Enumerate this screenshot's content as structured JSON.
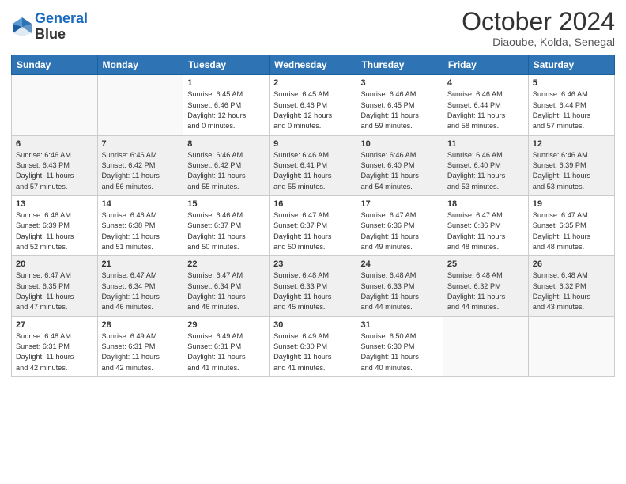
{
  "header": {
    "logo_line1": "General",
    "logo_line2": "Blue",
    "month": "October 2024",
    "location": "Diaoube, Kolda, Senegal"
  },
  "days_of_week": [
    "Sunday",
    "Monday",
    "Tuesday",
    "Wednesday",
    "Thursday",
    "Friday",
    "Saturday"
  ],
  "weeks": [
    [
      {
        "day": "",
        "info": ""
      },
      {
        "day": "",
        "info": ""
      },
      {
        "day": "1",
        "info": "Sunrise: 6:45 AM\nSunset: 6:46 PM\nDaylight: 12 hours\nand 0 minutes."
      },
      {
        "day": "2",
        "info": "Sunrise: 6:45 AM\nSunset: 6:46 PM\nDaylight: 12 hours\nand 0 minutes."
      },
      {
        "day": "3",
        "info": "Sunrise: 6:46 AM\nSunset: 6:45 PM\nDaylight: 11 hours\nand 59 minutes."
      },
      {
        "day": "4",
        "info": "Sunrise: 6:46 AM\nSunset: 6:44 PM\nDaylight: 11 hours\nand 58 minutes."
      },
      {
        "day": "5",
        "info": "Sunrise: 6:46 AM\nSunset: 6:44 PM\nDaylight: 11 hours\nand 57 minutes."
      }
    ],
    [
      {
        "day": "6",
        "info": "Sunrise: 6:46 AM\nSunset: 6:43 PM\nDaylight: 11 hours\nand 57 minutes."
      },
      {
        "day": "7",
        "info": "Sunrise: 6:46 AM\nSunset: 6:42 PM\nDaylight: 11 hours\nand 56 minutes."
      },
      {
        "day": "8",
        "info": "Sunrise: 6:46 AM\nSunset: 6:42 PM\nDaylight: 11 hours\nand 55 minutes."
      },
      {
        "day": "9",
        "info": "Sunrise: 6:46 AM\nSunset: 6:41 PM\nDaylight: 11 hours\nand 55 minutes."
      },
      {
        "day": "10",
        "info": "Sunrise: 6:46 AM\nSunset: 6:40 PM\nDaylight: 11 hours\nand 54 minutes."
      },
      {
        "day": "11",
        "info": "Sunrise: 6:46 AM\nSunset: 6:40 PM\nDaylight: 11 hours\nand 53 minutes."
      },
      {
        "day": "12",
        "info": "Sunrise: 6:46 AM\nSunset: 6:39 PM\nDaylight: 11 hours\nand 53 minutes."
      }
    ],
    [
      {
        "day": "13",
        "info": "Sunrise: 6:46 AM\nSunset: 6:39 PM\nDaylight: 11 hours\nand 52 minutes."
      },
      {
        "day": "14",
        "info": "Sunrise: 6:46 AM\nSunset: 6:38 PM\nDaylight: 11 hours\nand 51 minutes."
      },
      {
        "day": "15",
        "info": "Sunrise: 6:46 AM\nSunset: 6:37 PM\nDaylight: 11 hours\nand 50 minutes."
      },
      {
        "day": "16",
        "info": "Sunrise: 6:47 AM\nSunset: 6:37 PM\nDaylight: 11 hours\nand 50 minutes."
      },
      {
        "day": "17",
        "info": "Sunrise: 6:47 AM\nSunset: 6:36 PM\nDaylight: 11 hours\nand 49 minutes."
      },
      {
        "day": "18",
        "info": "Sunrise: 6:47 AM\nSunset: 6:36 PM\nDaylight: 11 hours\nand 48 minutes."
      },
      {
        "day": "19",
        "info": "Sunrise: 6:47 AM\nSunset: 6:35 PM\nDaylight: 11 hours\nand 48 minutes."
      }
    ],
    [
      {
        "day": "20",
        "info": "Sunrise: 6:47 AM\nSunset: 6:35 PM\nDaylight: 11 hours\nand 47 minutes."
      },
      {
        "day": "21",
        "info": "Sunrise: 6:47 AM\nSunset: 6:34 PM\nDaylight: 11 hours\nand 46 minutes."
      },
      {
        "day": "22",
        "info": "Sunrise: 6:47 AM\nSunset: 6:34 PM\nDaylight: 11 hours\nand 46 minutes."
      },
      {
        "day": "23",
        "info": "Sunrise: 6:48 AM\nSunset: 6:33 PM\nDaylight: 11 hours\nand 45 minutes."
      },
      {
        "day": "24",
        "info": "Sunrise: 6:48 AM\nSunset: 6:33 PM\nDaylight: 11 hours\nand 44 minutes."
      },
      {
        "day": "25",
        "info": "Sunrise: 6:48 AM\nSunset: 6:32 PM\nDaylight: 11 hours\nand 44 minutes."
      },
      {
        "day": "26",
        "info": "Sunrise: 6:48 AM\nSunset: 6:32 PM\nDaylight: 11 hours\nand 43 minutes."
      }
    ],
    [
      {
        "day": "27",
        "info": "Sunrise: 6:48 AM\nSunset: 6:31 PM\nDaylight: 11 hours\nand 42 minutes."
      },
      {
        "day": "28",
        "info": "Sunrise: 6:49 AM\nSunset: 6:31 PM\nDaylight: 11 hours\nand 42 minutes."
      },
      {
        "day": "29",
        "info": "Sunrise: 6:49 AM\nSunset: 6:31 PM\nDaylight: 11 hours\nand 41 minutes."
      },
      {
        "day": "30",
        "info": "Sunrise: 6:49 AM\nSunset: 6:30 PM\nDaylight: 11 hours\nand 41 minutes."
      },
      {
        "day": "31",
        "info": "Sunrise: 6:50 AM\nSunset: 6:30 PM\nDaylight: 11 hours\nand 40 minutes."
      },
      {
        "day": "",
        "info": ""
      },
      {
        "day": "",
        "info": ""
      }
    ]
  ]
}
